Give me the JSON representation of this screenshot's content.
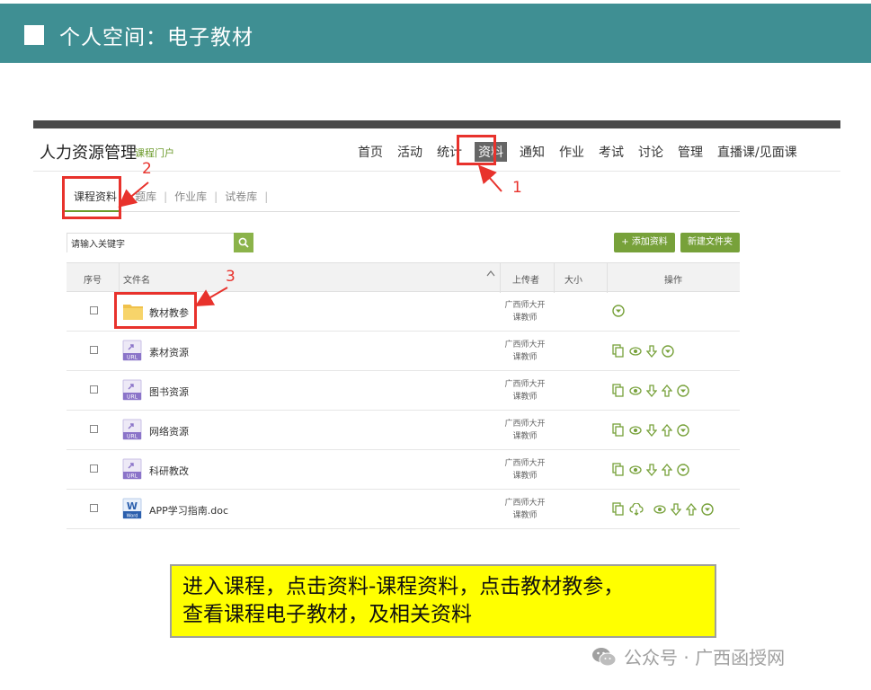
{
  "slide": {
    "title": "个人空间：电子教材"
  },
  "site": {
    "title": "人力资源管理",
    "subtitle": "课程门户",
    "nav": [
      "首页",
      "活动",
      "统计",
      "资料",
      "通知",
      "作业",
      "考试",
      "讨论",
      "管理",
      "直播课/见面课"
    ],
    "active_nav": "资料"
  },
  "subtabs": [
    "课程资料",
    "题库",
    "作业库",
    "试卷库"
  ],
  "search": {
    "placeholder": "请输入关键字"
  },
  "buttons": {
    "add_resource": "+ 添加资料",
    "new_folder": "新建文件夹"
  },
  "table": {
    "headers": {
      "index": "序号",
      "name": "文件名",
      "uploader": "上传者",
      "size": "大小",
      "ops": "操作"
    },
    "rows": [
      {
        "name": "教材教参",
        "type": "folder",
        "uploader_line1": "广西师大开",
        "uploader_line2": "课教师"
      },
      {
        "name": "素材资源",
        "type": "url",
        "uploader_line1": "广西师大开",
        "uploader_line2": "课教师"
      },
      {
        "name": "图书资源",
        "type": "url",
        "uploader_line1": "广西师大开",
        "uploader_line2": "课教师"
      },
      {
        "name": "网络资源",
        "type": "url",
        "uploader_line1": "广西师大开",
        "uploader_line2": "课教师"
      },
      {
        "name": "科研教改",
        "type": "url",
        "uploader_line1": "广西师大开",
        "uploader_line2": "课教师"
      },
      {
        "name": "APP学习指南.doc",
        "type": "word",
        "uploader_line1": "广西师大开",
        "uploader_line2": "课教师"
      }
    ],
    "url_icon_label": "URL",
    "word_icon_letter": "W",
    "word_icon_label": "Word"
  },
  "annotations": {
    "n1": "1",
    "n2": "2",
    "n3": "3"
  },
  "caption": {
    "line1": "进入课程，点击资料-课程资料，点击教材教参，",
    "line2": "查看课程电子教材，及相关资料"
  },
  "watermark": {
    "text": "公众号 · 广西函授网"
  },
  "colors": {
    "header_bg": "#3f8f93",
    "accent_green": "#77a13a",
    "annotation_red": "#e8322c",
    "caption_bg": "#ffff00"
  }
}
